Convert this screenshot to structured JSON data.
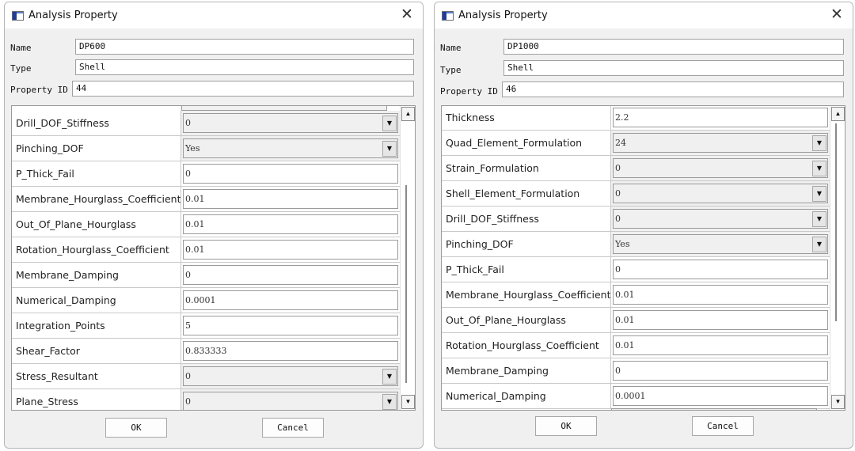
{
  "dialogs": [
    {
      "title": "Analysis Property",
      "name_label": "Name",
      "name_value": "DP600",
      "type_label": "Type",
      "type_value": "Shell",
      "id_label": "Property ID",
      "id_value": "44",
      "ok_label": "OK",
      "cancel_label": "Cancel",
      "rows": [
        {
          "name": "Drill_DOF_Stiffness",
          "value": "0",
          "kind": "combo"
        },
        {
          "name": "Pinching_DOF",
          "value": "Yes",
          "kind": "combo"
        },
        {
          "name": "P_Thick_Fail",
          "value": "0",
          "kind": "text"
        },
        {
          "name": "Membrane_Hourglass_Coefficient",
          "value": "0.01",
          "kind": "text"
        },
        {
          "name": "Out_Of_Plane_Hourglass",
          "value": "0.01",
          "kind": "text"
        },
        {
          "name": "Rotation_Hourglass_Coefficient",
          "value": "0.01",
          "kind": "text"
        },
        {
          "name": "Membrane_Damping",
          "value": "0",
          "kind": "text"
        },
        {
          "name": "Numerical_Damping",
          "value": "0.0001",
          "kind": "text"
        },
        {
          "name": "Integration_Points",
          "value": "5",
          "kind": "text"
        },
        {
          "name": "Shear_Factor",
          "value": "0.833333",
          "kind": "text"
        },
        {
          "name": "Stress_Resultant",
          "value": "0",
          "kind": "combo"
        },
        {
          "name": "Plane_Stress",
          "value": "0",
          "kind": "combo"
        }
      ]
    },
    {
      "title": "Analysis Property",
      "name_label": "Name",
      "name_value": "DP1000",
      "type_label": "Type",
      "type_value": "Shell",
      "id_label": "Property ID",
      "id_value": "46",
      "ok_label": "OK",
      "cancel_label": "Cancel",
      "rows": [
        {
          "name": "Thickness",
          "value": "2.2",
          "kind": "text"
        },
        {
          "name": "Quad_Element_Formulation",
          "value": "24",
          "kind": "combo"
        },
        {
          "name": "Strain_Formulation",
          "value": "0",
          "kind": "combo"
        },
        {
          "name": "Shell_Element_Formulation",
          "value": "0",
          "kind": "combo"
        },
        {
          "name": "Drill_DOF_Stiffness",
          "value": "0",
          "kind": "combo"
        },
        {
          "name": "Pinching_DOF",
          "value": "Yes",
          "kind": "combo"
        },
        {
          "name": "P_Thick_Fail",
          "value": "0",
          "kind": "text"
        },
        {
          "name": "Membrane_Hourglass_Coefficient",
          "value": "0.01",
          "kind": "text"
        },
        {
          "name": "Out_Of_Plane_Hourglass",
          "value": "0.01",
          "kind": "text"
        },
        {
          "name": "Rotation_Hourglass_Coefficient",
          "value": "0.01",
          "kind": "text"
        },
        {
          "name": "Membrane_Damping",
          "value": "0",
          "kind": "text"
        },
        {
          "name": "Numerical_Damping",
          "value": "0.0001",
          "kind": "text"
        }
      ]
    }
  ],
  "icons": {
    "app": "app-window-icon",
    "close": "close-icon",
    "dropdown": "chevron-down-icon",
    "scroll_up": "scroll-up-icon",
    "scroll_down": "scroll-down-icon"
  }
}
